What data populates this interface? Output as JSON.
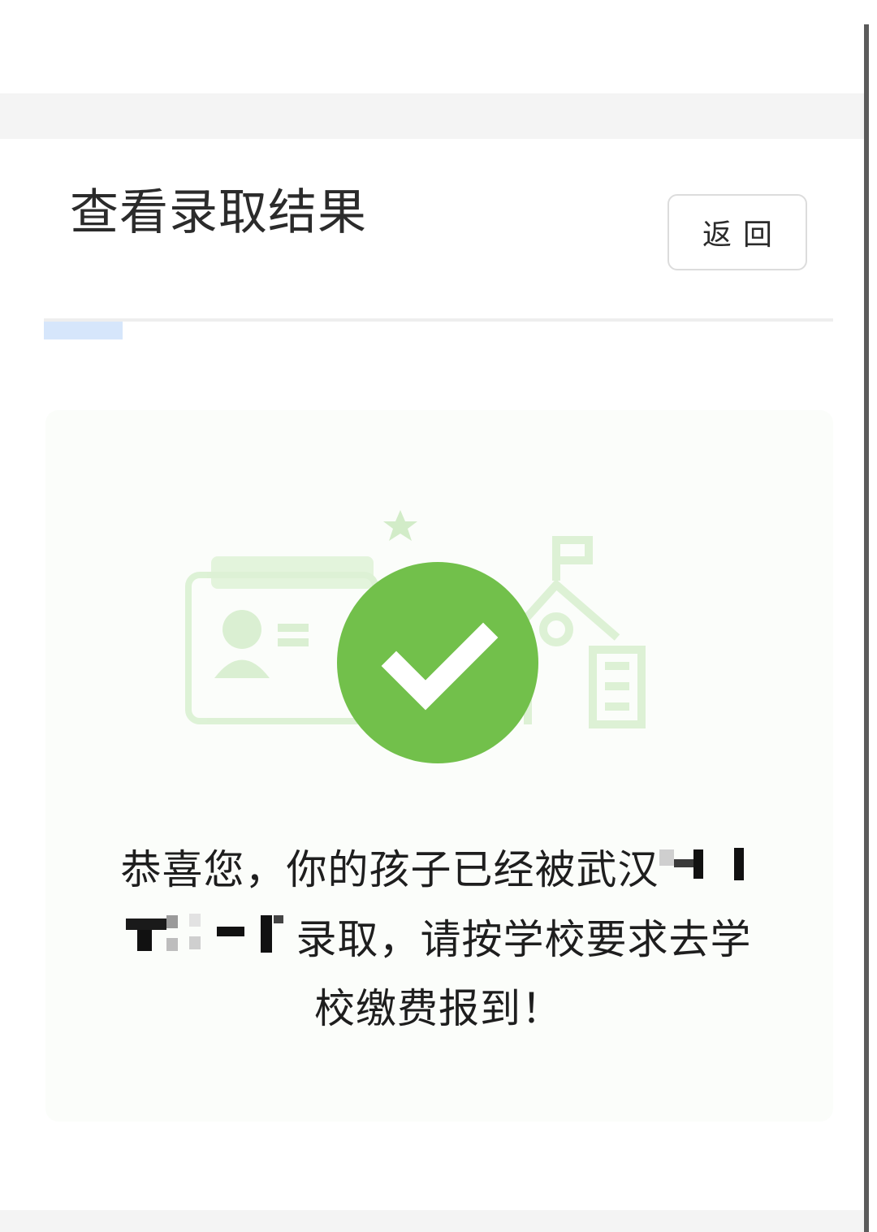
{
  "header": {
    "title": "查看录取结果",
    "back_label": "返回"
  },
  "result": {
    "message_line1": "恭喜您，你的孩子已经被武汉",
    "message_line2": "录取，请按学校要求去学",
    "message_line3": "校缴费报到！",
    "status_icon": "check-circle-icon",
    "accent_color": "#72c04b"
  },
  "illustration": {
    "icons": [
      "id-card-icon",
      "star-icon",
      "school-building-icon"
    ]
  }
}
